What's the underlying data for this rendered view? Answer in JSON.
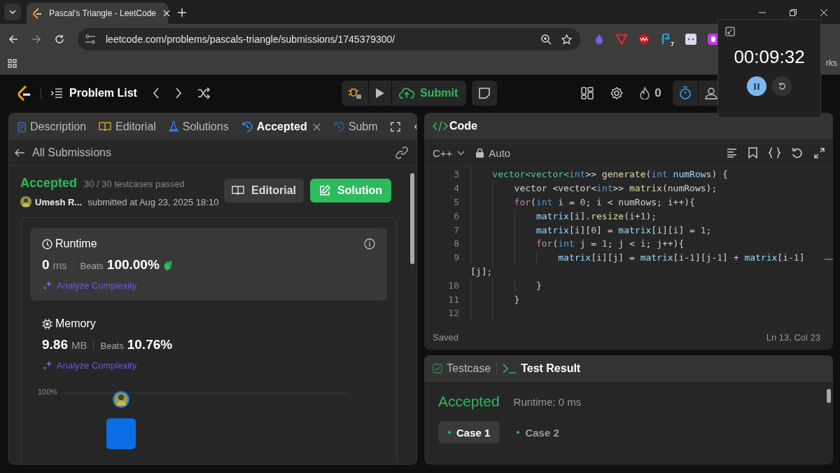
{
  "browser": {
    "tab_title": "Pascal's Triangle - LeetCode",
    "url": "leetcode.com/problems/pascals-triangle/submissions/1745379300/",
    "extension_badge": "7",
    "bookmarks_label": "rks"
  },
  "timer_popup": {
    "time": "00:09:32"
  },
  "nav": {
    "problem_list": "Problem List",
    "submit": "Submit",
    "streak": "0"
  },
  "left_tabs": [
    {
      "label": "Description",
      "kind": "description",
      "selected": false
    },
    {
      "label": "Editorial",
      "kind": "editorial",
      "selected": false
    },
    {
      "label": "Solutions",
      "kind": "solutions",
      "selected": false
    },
    {
      "label": "Accepted",
      "kind": "submission",
      "selected": true,
      "closable": true
    },
    {
      "label": "Subm",
      "kind": "submission",
      "selected": false
    }
  ],
  "back_link": "All Submissions",
  "submission": {
    "status": "Accepted",
    "passed": "30 / 30 testcases passed",
    "user": "Umesh R...",
    "submitted": "submitted at Aug 23, 2025 18:10",
    "editorial_button": "Editorial",
    "solution_button": "Solution"
  },
  "stats": [
    {
      "kind": "runtime",
      "title": "Runtime",
      "value": "0",
      "unit": "ms",
      "beats_label": "Beats",
      "beats": "100.00%",
      "analyze": "Analyze Complexity",
      "selected": true
    },
    {
      "kind": "memory",
      "title": "Memory",
      "value": "9.86",
      "unit": "MB",
      "beats_label": "Beats",
      "beats": "10.76%",
      "analyze": "Analyze Complexity",
      "selected": false
    }
  ],
  "distribution": {
    "tick": "100%"
  },
  "code_panel": {
    "title": "Code",
    "language": "C++",
    "mode": "Auto",
    "status": "Saved",
    "cursor": "Ln 13, Col 23"
  },
  "code_lines": [
    {
      "number": "3",
      "tokens": [
        {
          "text": "    vector<vector<",
          "kind": "type"
        },
        {
          "text": "int",
          "kind": "kw2"
        },
        {
          "text": ">> ",
          "kind": "plain"
        },
        {
          "text": "generate",
          "kind": "fn"
        },
        {
          "text": "(",
          "kind": "plain"
        },
        {
          "text": "int",
          "kind": "kw2"
        },
        {
          "text": " numRows",
          "kind": "var"
        },
        {
          "text": ") {",
          "kind": "plain"
        }
      ]
    },
    {
      "number": "4",
      "tokens": [
        {
          "text": "        vector <vector<",
          "kind": "plain"
        },
        {
          "text": "int",
          "kind": "kw2"
        },
        {
          "text": ">> ",
          "kind": "plain"
        },
        {
          "text": "matrix",
          "kind": "fn"
        },
        {
          "text": "(numRows);",
          "kind": "plain"
        }
      ]
    },
    {
      "number": "5",
      "tokens": [
        {
          "text": "        for",
          "kind": "kw"
        },
        {
          "text": "(",
          "kind": "plain"
        },
        {
          "text": "int",
          "kind": "kw2"
        },
        {
          "text": " i = ",
          "kind": "plain"
        },
        {
          "text": "0",
          "kind": "num"
        },
        {
          "text": "; i < numRows; i++){",
          "kind": "plain"
        }
      ]
    },
    {
      "number": "6",
      "tokens": [
        {
          "text": "            matrix",
          "kind": "var"
        },
        {
          "text": "[i].",
          "kind": "plain"
        },
        {
          "text": "resize",
          "kind": "fn"
        },
        {
          "text": "(i+",
          "kind": "plain"
        },
        {
          "text": "1",
          "kind": "num"
        },
        {
          "text": ");",
          "kind": "plain"
        }
      ]
    },
    {
      "number": "7",
      "tokens": [
        {
          "text": "            matrix",
          "kind": "var"
        },
        {
          "text": "[i][",
          "kind": "plain"
        },
        {
          "text": "0",
          "kind": "num"
        },
        {
          "text": "] = ",
          "kind": "plain"
        },
        {
          "text": "matrix",
          "kind": "var"
        },
        {
          "text": "[i][i] = ",
          "kind": "plain"
        },
        {
          "text": "1",
          "kind": "num"
        },
        {
          "text": ";",
          "kind": "plain"
        }
      ]
    },
    {
      "number": "8",
      "tokens": [
        {
          "text": "            for",
          "kind": "kw"
        },
        {
          "text": "(",
          "kind": "plain"
        },
        {
          "text": "int",
          "kind": "kw2"
        },
        {
          "text": " j = ",
          "kind": "plain"
        },
        {
          "text": "1",
          "kind": "num"
        },
        {
          "text": "; j < i; j++){",
          "kind": "plain"
        }
      ]
    },
    {
      "number": "9",
      "tokens": [
        {
          "text": "                matrix",
          "kind": "var"
        },
        {
          "text": "[i][j] = ",
          "kind": "plain"
        },
        {
          "text": "matrix",
          "kind": "var"
        },
        {
          "text": "[i-",
          "kind": "plain"
        },
        {
          "text": "1",
          "kind": "num"
        },
        {
          "text": "][j-",
          "kind": "plain"
        },
        {
          "text": "1",
          "kind": "num"
        },
        {
          "text": "] + ",
          "kind": "plain"
        },
        {
          "text": "matrix",
          "kind": "var"
        },
        {
          "text": "[i-",
          "kind": "plain"
        },
        {
          "text": "1",
          "kind": "num"
        },
        {
          "text": "]",
          "kind": "plain"
        }
      ]
    },
    {
      "tokens": [
        {
          "text": "[j];",
          "kind": "plain"
        }
      ]
    },
    {
      "number": "10",
      "tokens": [
        {
          "text": "            }",
          "kind": "plain"
        }
      ]
    },
    {
      "number": "11",
      "tokens": [
        {
          "text": "        }",
          "kind": "plain"
        }
      ]
    },
    {
      "number": "12"
    }
  ],
  "result_tabs": [
    {
      "label": "Testcase",
      "kind": "testcase",
      "selected": false
    },
    {
      "label": "Test Result",
      "kind": "result",
      "selected": true
    }
  ],
  "result": {
    "status": "Accepted",
    "runtime": "Runtime: 0 ms"
  },
  "cases": [
    {
      "label": "Case 1",
      "selected": true
    },
    {
      "label": "Case 2",
      "selected": false
    }
  ]
}
